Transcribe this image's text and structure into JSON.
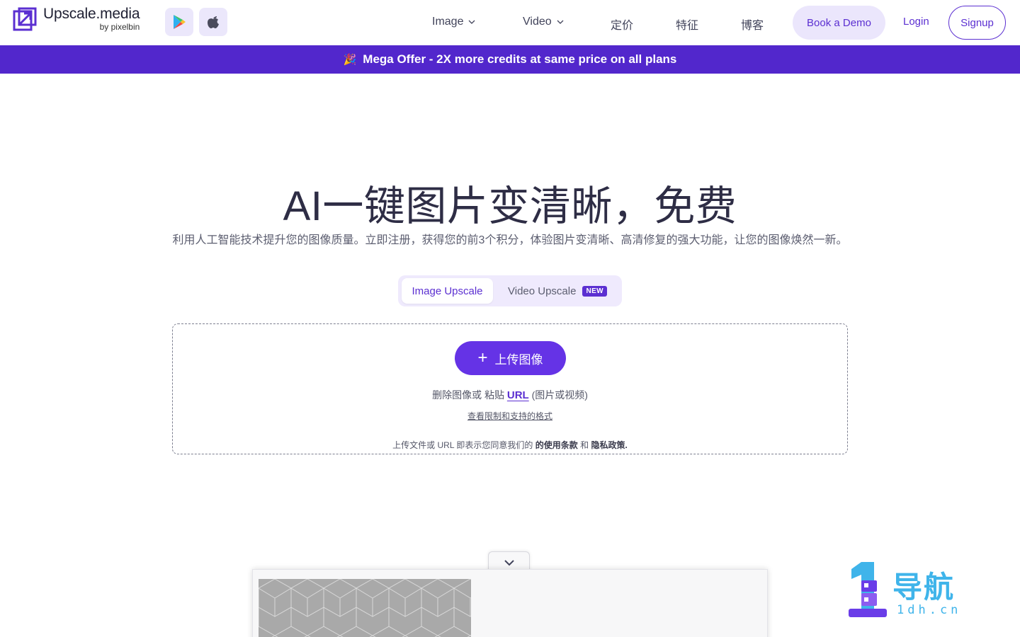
{
  "brand": {
    "name": "Upscale.media",
    "by": "by pixelbin",
    "accent": "#5b2fd1",
    "banner_color": "#5227cc"
  },
  "header": {
    "stores": [
      {
        "icon": "google-play-icon"
      },
      {
        "icon": "apple-icon"
      }
    ],
    "nav": {
      "image": "Image",
      "video": "Video",
      "pricing": "定价",
      "features": "特征",
      "blog": "博客"
    },
    "book_demo": "Book a Demo",
    "login": "Login",
    "signup": "Signup"
  },
  "offer": {
    "emoji": "🎉",
    "text": "Mega Offer - 2X more credits at same price on all plans"
  },
  "hero": {
    "title": "AI一键图片变清晰，免费",
    "subtitle": "利用人工智能技术提升您的图像质量。立即注册，获得您的前3个积分，体验图片变清晰、高清修复的强大功能，让您的图像焕然一新。"
  },
  "tabs": {
    "image": "Image Upscale",
    "video": "Video Upscale",
    "new_badge": "NEW",
    "selected": "Image Upscale"
  },
  "upload": {
    "button": "上传图像",
    "drop_text": "删除图像或 粘贴",
    "url": "URL",
    "url_suffix": "(图片或视频)",
    "limits": "查看限制和支持的格式",
    "terms_prefix": "上传文件或 URL 即表示您同意我们的",
    "terms_link": "的使用条款",
    "terms_and": "和",
    "privacy_link": "隐私政策."
  },
  "watermark": {
    "cn": "导航",
    "en": "1dh.cn"
  }
}
